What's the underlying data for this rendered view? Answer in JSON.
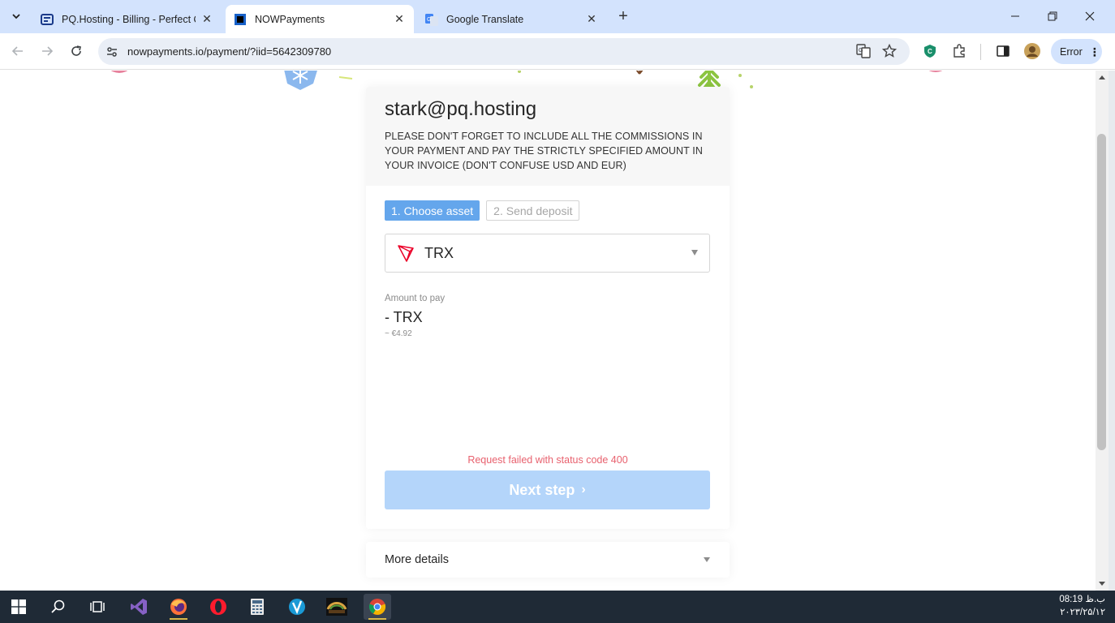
{
  "browser": {
    "tabs": [
      {
        "title": "PQ.Hosting - Billing - Perfect Q",
        "active": false
      },
      {
        "title": "NOWPayments",
        "active": true
      },
      {
        "title": "Google Translate",
        "active": false
      }
    ],
    "url": "nowpayments.io/payment/?iid=5642309780",
    "profile_status": "Error",
    "icons": [
      "tab-search-icon",
      "minimize-icon",
      "restore-icon",
      "close-icon",
      "back-icon",
      "forward-icon",
      "reload-icon",
      "site-info-icon",
      "translate-icon",
      "bookmark-star-icon",
      "shield-extension-icon",
      "extensions-puzzle-icon",
      "side-panel-icon",
      "profile-avatar"
    ]
  },
  "payment": {
    "email": "stark@pq.hosting",
    "notice": "PLEASE DON'T FORGET TO INCLUDE ALL THE COMMISSIONS IN YOUR PAYMENT AND PAY THE STRICTLY SPECIFIED AMOUNT IN YOUR INVOICE (DON'T CONFUSE USD AND EUR)",
    "steps": [
      "1. Choose asset",
      "2. Send deposit"
    ],
    "active_step": 1,
    "selected_asset": "TRX",
    "amount_label": "Amount to pay",
    "amount_value": "- TRX",
    "amount_fiat": "~ €4.92",
    "error": "Request failed with status code 400",
    "next_button": "Next step",
    "more_details": "More details"
  },
  "colors": {
    "accent": "#64a6ec",
    "button_disabled": "#b4d5fa",
    "error": "#e8616e",
    "tron_red": "#eb0029"
  },
  "taskbar": {
    "apps": [
      "windows-start",
      "search",
      "task-view",
      "visual-studio",
      "firefox",
      "opera",
      "calculator",
      "veeam",
      "alpari",
      "chrome"
    ],
    "time": "08:19 ب.ظ",
    "date": "۲۰۲۳/۲۵/۱۲"
  }
}
